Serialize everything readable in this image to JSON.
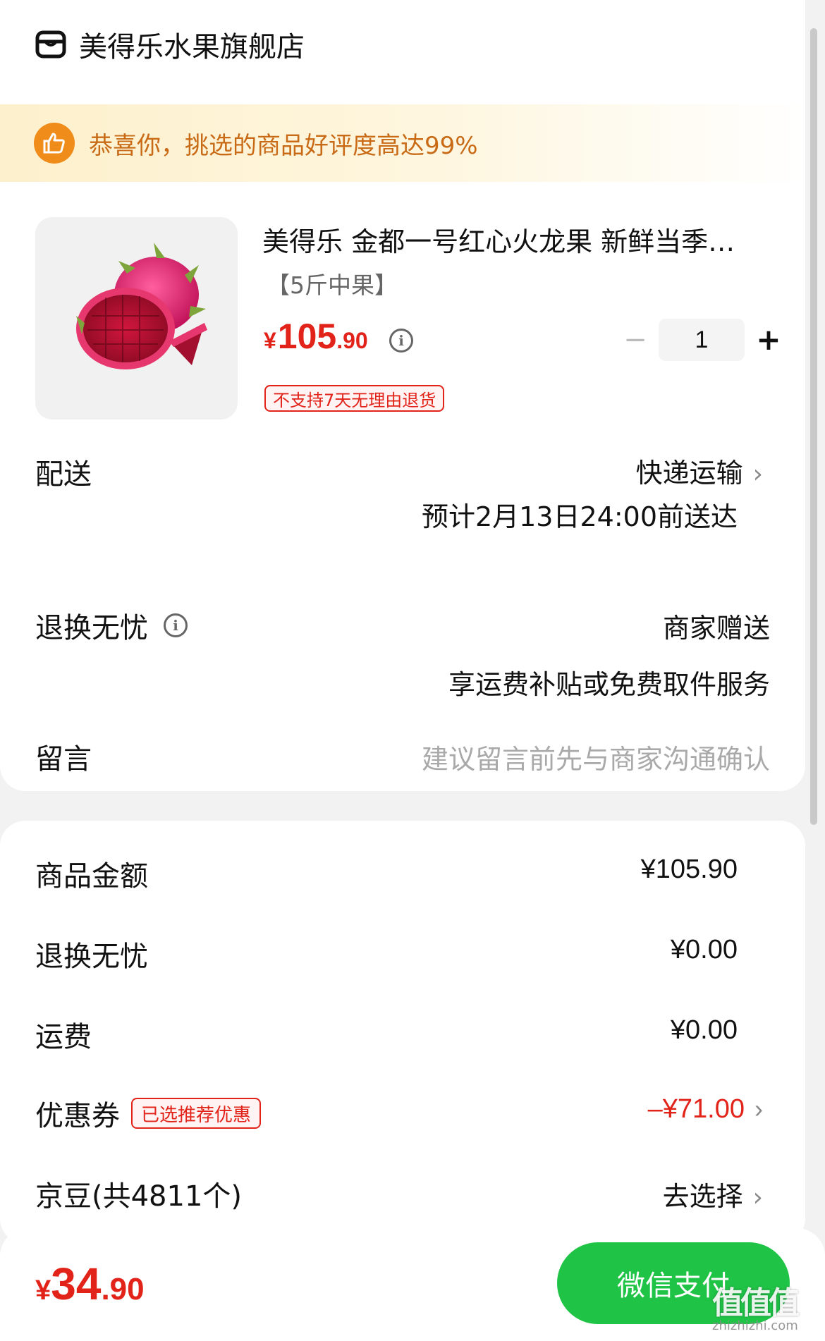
{
  "store": {
    "name": "美得乐水果旗舰店",
    "icon": "store-icon"
  },
  "banner": {
    "text": "恭喜你，挑选的商品好评度高达99%",
    "icon": "thumbs-up-icon"
  },
  "product": {
    "title": "美得乐 金都一号红心火龙果 新鲜当季…",
    "spec": "【5斤中果】",
    "price": {
      "symbol": "¥",
      "integer": "105",
      "decimal": ".90"
    },
    "quantity": "1",
    "minus": "−",
    "plus": "+",
    "tag": "不支持7天无理由退货",
    "image_icon": "dragon-fruit-image"
  },
  "delivery": {
    "label": "配送",
    "method": "快递运输",
    "eta": "预计2月13日24:00前送达"
  },
  "returns": {
    "label": "退换无忧",
    "value": "商家赠送",
    "detail": "享运费补贴或免费取件服务"
  },
  "message": {
    "label": "留言",
    "placeholder": "建议留言前先与商家沟通确认"
  },
  "costs": {
    "goods": {
      "label": "商品金额",
      "value": "¥105.90"
    },
    "returns": {
      "label": "退换无忧",
      "value": "¥0.00"
    },
    "shipping": {
      "label": "运费",
      "value": "¥0.00"
    },
    "coupon": {
      "label": "优惠券",
      "tag": "已选推荐优惠",
      "value": "–¥71.00"
    },
    "jd_beans": {
      "label": "京豆(共4811个)",
      "value": "去选择"
    }
  },
  "footer": {
    "total": {
      "symbol": "¥",
      "integer": "34",
      "decimal": ".90"
    },
    "pay_label": "微信支付"
  },
  "watermark": {
    "logo": "值值值",
    "domain": "zhizhizhi.com"
  },
  "colors": {
    "accent_red": "#e2231a",
    "pay_green": "#1fc447",
    "banner_orange": "#f08c1a"
  }
}
